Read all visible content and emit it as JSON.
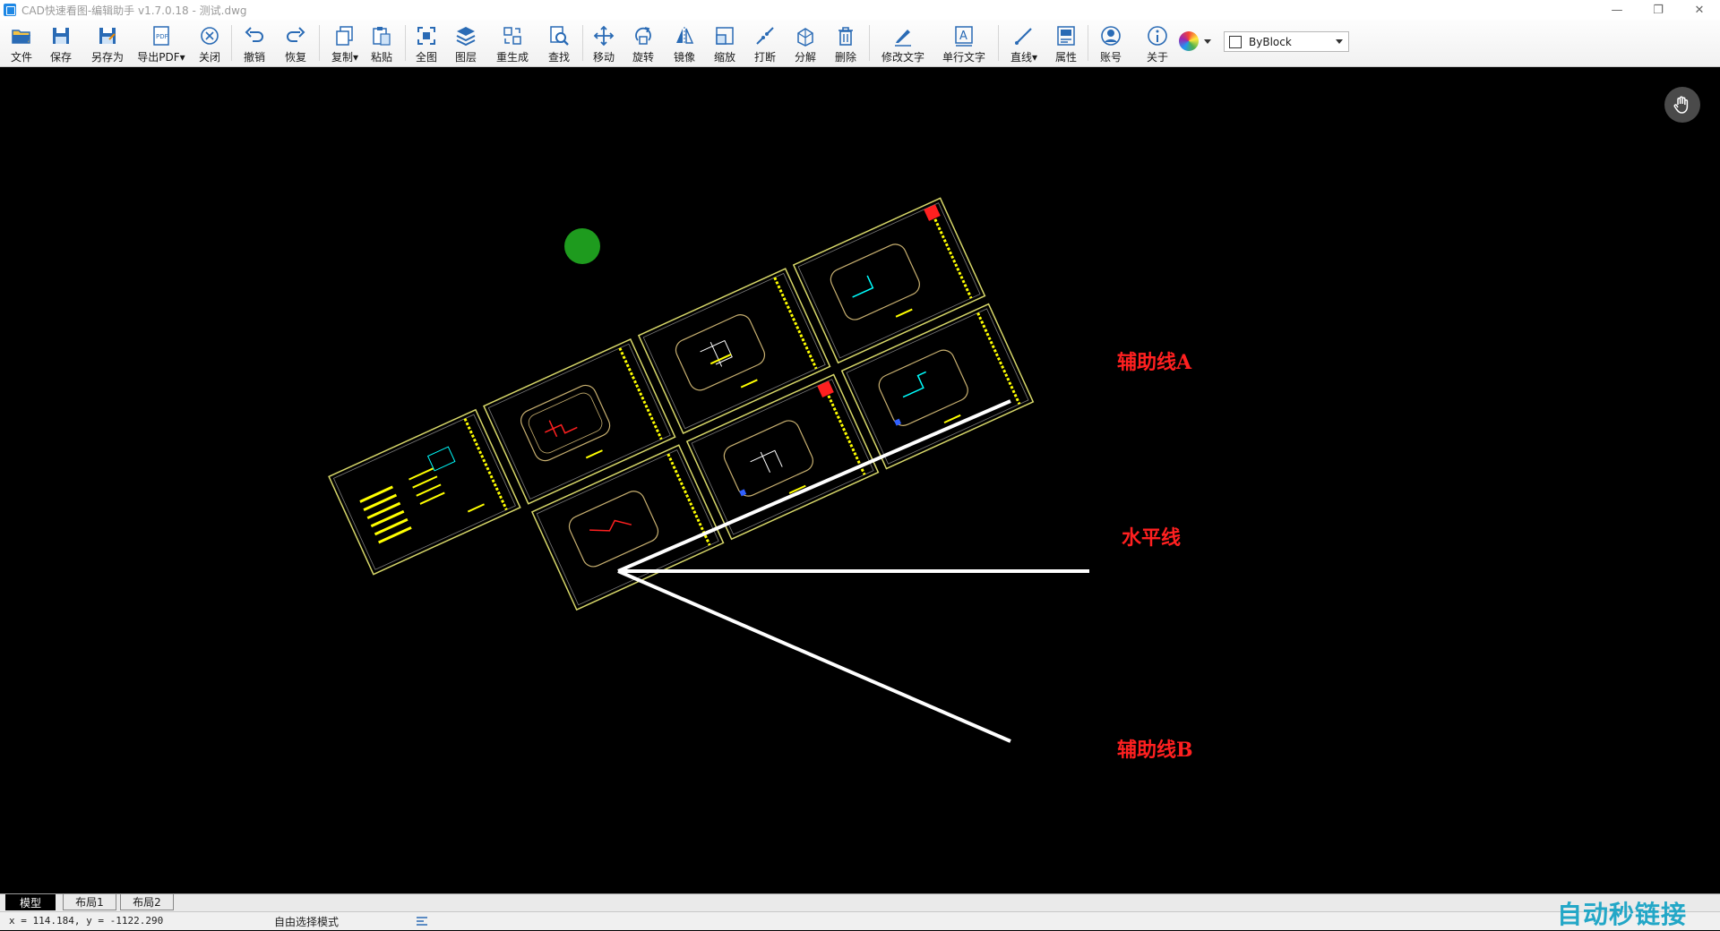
{
  "window": {
    "title": "CAD快速看图-编辑助手 v1.7.0.18 - 测试.dwg",
    "controls": [
      "—",
      "❐",
      "✕"
    ]
  },
  "toolbar": {
    "items": [
      {
        "label": "文件",
        "icon": "folder-open-icon"
      },
      {
        "label": "保存",
        "icon": "save-icon"
      },
      {
        "label": "另存为",
        "icon": "save-as-icon"
      },
      {
        "label": "导出PDF▾",
        "icon": "export-pdf-icon"
      },
      {
        "label": "关闭",
        "icon": "close-circle-icon"
      },
      {
        "label": "撤销",
        "icon": "undo-icon"
      },
      {
        "label": "恢复",
        "icon": "redo-icon"
      },
      {
        "label": "复制▾",
        "icon": "copy-icon"
      },
      {
        "label": "粘贴",
        "icon": "paste-icon"
      },
      {
        "label": "全图",
        "icon": "zoom-extents-icon"
      },
      {
        "label": "图层",
        "icon": "layers-icon"
      },
      {
        "label": "重生成",
        "icon": "regenerate-icon"
      },
      {
        "label": "查找",
        "icon": "find-icon"
      },
      {
        "label": "移动",
        "icon": "move-icon"
      },
      {
        "label": "旋转",
        "icon": "rotate-icon"
      },
      {
        "label": "镜像",
        "icon": "mirror-icon"
      },
      {
        "label": "缩放",
        "icon": "scale-icon"
      },
      {
        "label": "打断",
        "icon": "break-icon"
      },
      {
        "label": "分解",
        "icon": "explode-icon"
      },
      {
        "label": "删除",
        "icon": "delete-icon"
      },
      {
        "label": "修改文字",
        "icon": "edit-text-icon"
      },
      {
        "label": "单行文字",
        "icon": "single-line-text-icon"
      },
      {
        "label": "直线▾",
        "icon": "line-icon"
      },
      {
        "label": "属性",
        "icon": "properties-icon"
      },
      {
        "label": "账号",
        "icon": "account-icon"
      },
      {
        "label": "关于",
        "icon": "info-icon"
      }
    ],
    "color_picker": {
      "icon": "color-wheel-icon"
    },
    "linetype": {
      "value": "ByBlock"
    }
  },
  "canvas": {
    "background": "#000000",
    "annotations": [
      {
        "text": "辅助线A",
        "color": "#ff2020"
      },
      {
        "text": "水平线",
        "color": "#ff2020"
      },
      {
        "text": "辅助线B",
        "color": "#ff2020"
      }
    ],
    "pan_button": {
      "icon": "hand-pan-icon"
    }
  },
  "tabs": [
    "模型",
    "布局1",
    "布局2"
  ],
  "active_tab": "模型",
  "status": {
    "coords": "x = 114.184, y = -1122.290",
    "mode": "自由选择模式"
  },
  "watermark": "自动秒链接"
}
